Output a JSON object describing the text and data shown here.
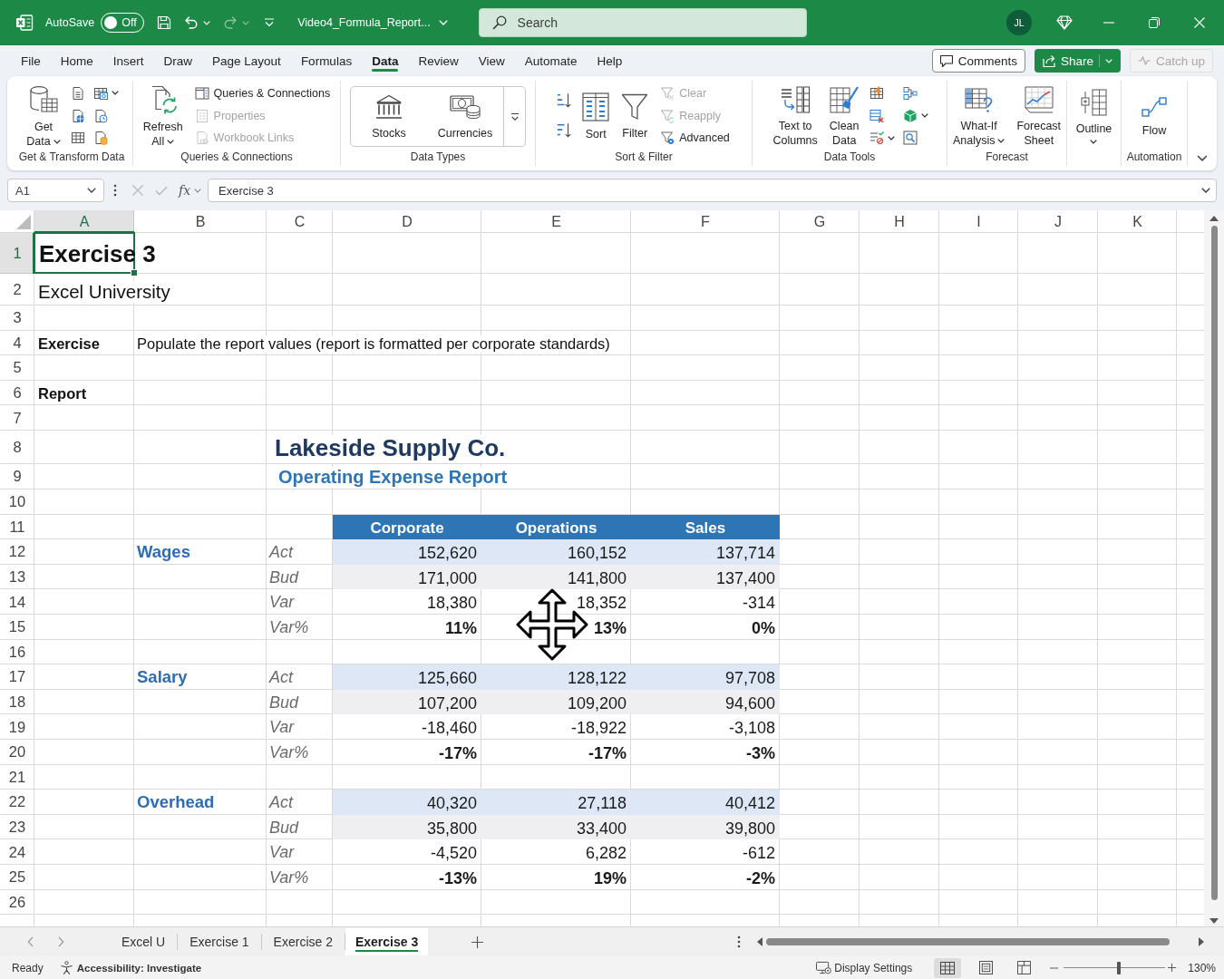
{
  "title_bar": {
    "autosave": {
      "label": "AutoSave",
      "on": false,
      "state_text": "Off"
    },
    "undo_disabled": false,
    "redo_disabled": true,
    "file_name": "Video4_Formula_Report...",
    "search": {
      "placeholder": "Search"
    },
    "avatar": "JL"
  },
  "menu": {
    "tabs": [
      {
        "label": "File",
        "selected": false
      },
      {
        "label": "Home",
        "selected": false
      },
      {
        "label": "Insert",
        "selected": false
      },
      {
        "label": "Draw",
        "selected": false
      },
      {
        "label": "Page Layout",
        "selected": false
      },
      {
        "label": "Formulas",
        "selected": false
      },
      {
        "label": "Data",
        "selected": true
      },
      {
        "label": "Review",
        "selected": false
      },
      {
        "label": "View",
        "selected": false
      },
      {
        "label": "Automate",
        "selected": false
      },
      {
        "label": "Help",
        "selected": false
      }
    ],
    "actions": [
      {
        "label": "Comments",
        "kind": "outline",
        "disabled": false
      },
      {
        "label": "Share",
        "kind": "primary",
        "disabled": false
      },
      {
        "label": "Catch up",
        "kind": "outline",
        "disabled": true
      }
    ]
  },
  "ribbon": {
    "groups": [
      {
        "label": "Get & Transform Data",
        "items": [
          {
            "kind": "large",
            "label": "Get\nData",
            "has_menu": true
          },
          {
            "kind": "icon",
            "has_menu": false
          },
          {
            "kind": "icon",
            "has_menu": false
          },
          {
            "kind": "icon",
            "has_menu": false
          },
          {
            "kind": "icon",
            "has_menu": true
          },
          {
            "kind": "icon",
            "has_menu": false
          },
          {
            "kind": "icon",
            "has_menu": false
          }
        ]
      },
      {
        "label": "Queries & Connections",
        "items": [
          {
            "kind": "large",
            "label": "Refresh\nAll",
            "has_menu": true
          },
          {
            "kind": "small",
            "label": "Queries & Connections",
            "disabled": false
          },
          {
            "kind": "small",
            "label": "Properties",
            "disabled": true
          },
          {
            "kind": "small",
            "label": "Workbook Links",
            "disabled": true
          }
        ]
      },
      {
        "label": "Data Types",
        "items": [
          {
            "kind": "gallery",
            "options": [
              "Stocks",
              "Currencies"
            ]
          }
        ]
      },
      {
        "label": "Sort & Filter",
        "items": [
          {
            "kind": "icon",
            "has_menu": false
          },
          {
            "kind": "icon",
            "has_menu": false
          },
          {
            "kind": "large",
            "label": "Sort",
            "has_menu": false
          },
          {
            "kind": "large",
            "label": "Filter",
            "has_menu": false
          },
          {
            "kind": "small",
            "label": "Clear",
            "disabled": true
          },
          {
            "kind": "small",
            "label": "Reapply",
            "disabled": true
          },
          {
            "kind": "small",
            "label": "Advanced",
            "disabled": false
          }
        ]
      },
      {
        "label": "Data Tools",
        "items": [
          {
            "kind": "large",
            "label": "Text to\nColumns",
            "has_menu": false
          },
          {
            "kind": "large",
            "label": "Clean\nData",
            "has_menu": false
          },
          {
            "kind": "icon",
            "has_menu": false
          },
          {
            "kind": "icon",
            "has_menu": false
          },
          {
            "kind": "icon",
            "has_menu": true
          },
          {
            "kind": "icon",
            "has_menu": false
          },
          {
            "kind": "icon",
            "has_menu": true
          },
          {
            "kind": "icon",
            "has_menu": false
          }
        ]
      },
      {
        "label": "Forecast",
        "items": [
          {
            "kind": "large",
            "label": "What-If\nAnalysis",
            "has_menu": true
          },
          {
            "kind": "large",
            "label": "Forecast\nSheet",
            "has_menu": false
          }
        ]
      },
      {
        "items": [
          {
            "kind": "large",
            "label": "Outline",
            "has_menu": true
          }
        ]
      },
      {
        "label": "Automation",
        "items": [
          {
            "kind": "large",
            "label": "Flow",
            "has_menu": false
          }
        ]
      }
    ]
  },
  "formula_bar": {
    "name_box": "A1",
    "function_label": "fx",
    "formula": "Exercise 3"
  },
  "sheet": {
    "columns": [
      {
        "label": "A",
        "selected": true
      },
      {
        "label": "B",
        "selected": false
      },
      {
        "label": "C",
        "selected": false
      },
      {
        "label": "D",
        "selected": false
      },
      {
        "label": "E",
        "selected": false
      },
      {
        "label": "F",
        "selected": false
      },
      {
        "label": "G",
        "selected": false
      },
      {
        "label": "H",
        "selected": false
      },
      {
        "label": "I",
        "selected": false
      },
      {
        "label": "J",
        "selected": false
      },
      {
        "label": "K",
        "selected": false
      }
    ],
    "rows": [
      {
        "label": "1",
        "selected": true
      },
      {
        "label": "2",
        "selected": false
      },
      {
        "label": "3",
        "selected": false
      },
      {
        "label": "4",
        "selected": false
      },
      {
        "label": "5",
        "selected": false
      },
      {
        "label": "6",
        "selected": false
      },
      {
        "label": "7",
        "selected": false
      },
      {
        "label": "8",
        "selected": false
      },
      {
        "label": "9",
        "selected": false
      },
      {
        "label": "10",
        "selected": false
      },
      {
        "label": "11",
        "selected": false
      },
      {
        "label": "12",
        "selected": false
      },
      {
        "label": "13",
        "selected": false
      },
      {
        "label": "14",
        "selected": false
      },
      {
        "label": "15",
        "selected": false
      },
      {
        "label": "16",
        "selected": false
      },
      {
        "label": "17",
        "selected": false
      },
      {
        "label": "18",
        "selected": false
      },
      {
        "label": "19",
        "selected": false
      },
      {
        "label": "20",
        "selected": false
      },
      {
        "label": "21",
        "selected": false
      },
      {
        "label": "22",
        "selected": false
      },
      {
        "label": "23",
        "selected": false
      },
      {
        "label": "24",
        "selected": false
      },
      {
        "label": "25",
        "selected": false
      },
      {
        "label": "26",
        "selected": false
      }
    ],
    "title": {
      "text": "Exercise 3",
      "selected": true
    },
    "subtitle": "Excel University",
    "exercise": {
      "label": "Exercise",
      "text": "Populate the report values (report is formatted per corporate standards)"
    },
    "report_label": "Report",
    "report": {
      "company": "Lakeside Supply Co.",
      "title": "Operating Expense Report",
      "columns": [
        "Corporate",
        "Operations",
        "Sales"
      ],
      "sections": [
        {
          "name": "Wages",
          "rows": [
            {
              "label": "Act",
              "kind": "act",
              "values": [
                "152,620",
                "160,152",
                "137,714"
              ]
            },
            {
              "label": "Bud",
              "kind": "bud",
              "values": [
                "171,000",
                "141,800",
                "137,400"
              ]
            },
            {
              "label": "Var",
              "kind": "var",
              "values": [
                "18,380",
                "18,352",
                "-314"
              ]
            },
            {
              "label": "Var%",
              "kind": "pct",
              "values": [
                "11%",
                "13%",
                "0%"
              ]
            }
          ]
        },
        {
          "name": "Salary",
          "rows": [
            {
              "label": "Act",
              "kind": "act",
              "values": [
                "125,660",
                "128,122",
                "97,708"
              ]
            },
            {
              "label": "Bud",
              "kind": "bud",
              "values": [
                "107,200",
                "109,200",
                "94,600"
              ]
            },
            {
              "label": "Var",
              "kind": "var",
              "values": [
                "-18,460",
                "-18,922",
                "-3,108"
              ]
            },
            {
              "label": "Var%",
              "kind": "pct",
              "values": [
                "-17%",
                "-17%",
                "-3%"
              ]
            }
          ]
        },
        {
          "name": "Overhead",
          "rows": [
            {
              "label": "Act",
              "kind": "act",
              "values": [
                "40,320",
                "27,118",
                "40,412"
              ]
            },
            {
              "label": "Bud",
              "kind": "bud",
              "values": [
                "35,800",
                "33,400",
                "39,800"
              ]
            },
            {
              "label": "Var",
              "kind": "var",
              "values": [
                "-4,520",
                "6,282",
                "-612"
              ]
            },
            {
              "label": "Var%",
              "kind": "pct",
              "values": [
                "-13%",
                "19%",
                "-2%"
              ]
            }
          ]
        }
      ]
    }
  },
  "sheet_tabs": {
    "tabs": [
      {
        "label": "Excel U",
        "selected": false
      },
      {
        "label": "Exercise 1",
        "selected": false
      },
      {
        "label": "Exercise 2",
        "selected": false
      },
      {
        "label": "Exercise 3",
        "selected": true
      }
    ]
  },
  "status_bar": {
    "mode": "Ready",
    "accessibility": "Accessibility: Investigate",
    "display_settings": "Display Settings",
    "views": [
      {
        "selected": true
      },
      {
        "selected": false
      },
      {
        "selected": false
      }
    ],
    "zoom": {
      "level": 0.54,
      "label": "130%"
    }
  }
}
